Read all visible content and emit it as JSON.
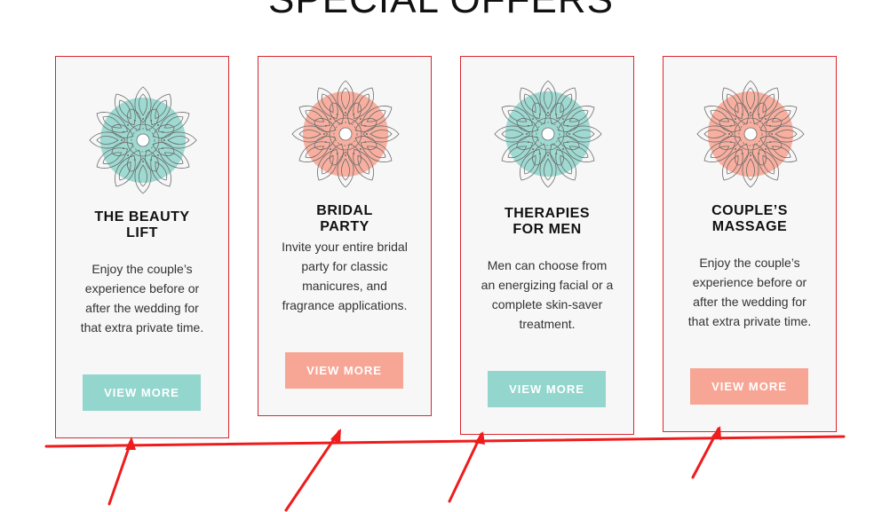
{
  "section": {
    "title": "SPECIAL OFFERS"
  },
  "cards": [
    {
      "title": "THE BEAUTY LIFT",
      "description": "Enjoy the couple’s experience before or after the wedding for that extra private time.",
      "button_label": "VIEW MORE",
      "theme": "teal",
      "accent": "#93d6cd"
    },
    {
      "title": "BRIDAL PARTY",
      "description": "Invite your entire bridal party for classic manicures, and fragrance applications.",
      "button_label": "VIEW MORE",
      "theme": "peach",
      "accent": "#f7a695"
    },
    {
      "title": "THERAPIES FOR MEN",
      "description": "Men can choose from an energizing facial or a complete skin-saver treatment.",
      "button_label": "VIEW MORE",
      "theme": "teal",
      "accent": "#93d6cd"
    },
    {
      "title": "COUPLE’S MASSAGE",
      "description": "Enjoy the couple’s experience before or after the wedding for that extra private time.",
      "button_label": "VIEW MORE",
      "theme": "peach",
      "accent": "#f7a695"
    }
  ],
  "colors": {
    "card_border": "#d9262e",
    "card_bg": "#f7f7f7",
    "annotation": "#ee1c1c"
  },
  "icons": [
    "mandala-icon"
  ]
}
